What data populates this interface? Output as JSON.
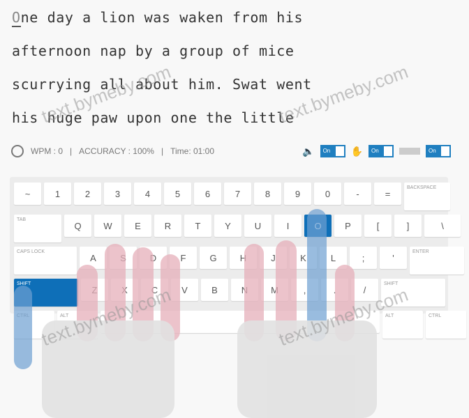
{
  "text": {
    "cursor_char": "O",
    "lines": [
      "ne day a lion was waken from his",
      "afternoon nap by a group of mice",
      "scurrying all about him. Swat went",
      "his huge paw upon one the little"
    ]
  },
  "stats": {
    "wpm": "WPM : 0",
    "sep": "|",
    "accuracy": "ACCURACY : 100%",
    "time": "Time: 01:00"
  },
  "toggles": [
    {
      "label": "On",
      "icon": "sound-icon"
    },
    {
      "label": "On",
      "icon": "hands-icon"
    },
    {
      "label": "On",
      "icon": "keyboard-icon"
    }
  ],
  "keyboard": {
    "rows": [
      [
        "~",
        "1",
        "2",
        "3",
        "4",
        "5",
        "6",
        "7",
        "8",
        "9",
        "0",
        "-",
        "=",
        "BACKSPACE"
      ],
      [
        "TAB",
        "Q",
        "W",
        "E",
        "R",
        "T",
        "Y",
        "U",
        "I",
        "O",
        "P",
        "[",
        "]",
        "\\"
      ],
      [
        "CAPS LOCK",
        "A",
        "S",
        "D",
        "F",
        "G",
        "H",
        "J",
        "K",
        "L",
        ";",
        "'",
        "ENTER"
      ],
      [
        "SHIFT",
        "Z",
        "X",
        "C",
        "V",
        "B",
        "N",
        "M",
        ",",
        ".",
        "/",
        "SHIFT"
      ],
      [
        "CTRL",
        "ALT",
        " ",
        "ALT",
        "CTRL"
      ]
    ],
    "highlighted": [
      "O",
      "SHIFT"
    ],
    "highlight_color": "#0e6fb8"
  },
  "watermark": "text.bymeby.com"
}
